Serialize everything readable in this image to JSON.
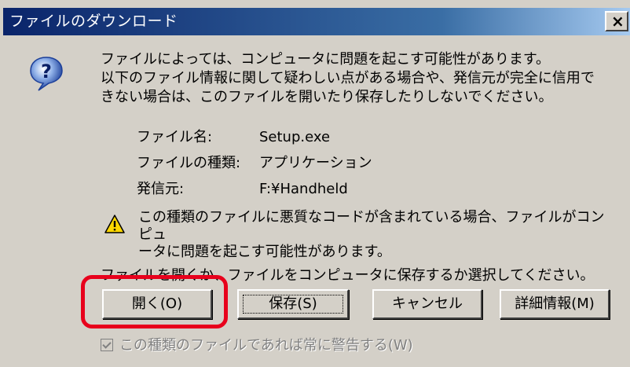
{
  "window": {
    "title": "ファイルのダウンロード",
    "close_label": "×"
  },
  "message": {
    "intro": "ファイルによっては、コンピュータに問題を起こす可能性があります。\n以下のファイル情報に関して疑わしい点がある場合や、発信元が完全に信用で\nきない場合は、このファイルを開いたり保存したりしないでください。"
  },
  "file_info": [
    {
      "label": "ファイル名:",
      "value": "Setup.exe"
    },
    {
      "label": "ファイルの種類:",
      "value": "アプリケーション"
    },
    {
      "label": "発信元:",
      "value": "F:¥Handheld"
    }
  ],
  "warning": {
    "text": "この種類のファイルに悪質なコードが含まれている場合、ファイルがコンピュ\nータに問題を起こす可能性があります。"
  },
  "question": "ファイルを開くか、ファイルをコンピュータに保存するか選択してください。",
  "buttons": {
    "open": "開く(O)",
    "save": "保存(S)",
    "cancel": "キャンセル",
    "details": "詳細情報(M)"
  },
  "checkbox": {
    "label": "この種類のファイルであれば常に警告する(W)",
    "checked": true,
    "disabled": true
  },
  "colors": {
    "dialog_bg": "#d4d0c8",
    "titlebar": "#0a246a",
    "highlight": "#e8001c"
  },
  "icons": {
    "question": "question-icon",
    "warning": "warning-icon",
    "close": "close-icon"
  }
}
